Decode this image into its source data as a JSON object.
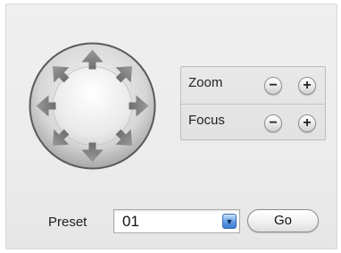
{
  "ptz": {
    "icon": "ptz-direction-pad-icon",
    "directions": [
      "up",
      "up-right",
      "right",
      "down-right",
      "down",
      "down-left",
      "left",
      "up-left"
    ]
  },
  "lens": {
    "zoom_label": "Zoom",
    "focus_label": "Focus",
    "minus_glyph": "−",
    "plus_glyph": "+"
  },
  "preset": {
    "label": "Preset",
    "value": "01",
    "dropdown_icon": "chevron-down-icon",
    "go_label": "Go"
  },
  "colors": {
    "panel": "#ececec",
    "select_accent": "#4a86d8"
  }
}
